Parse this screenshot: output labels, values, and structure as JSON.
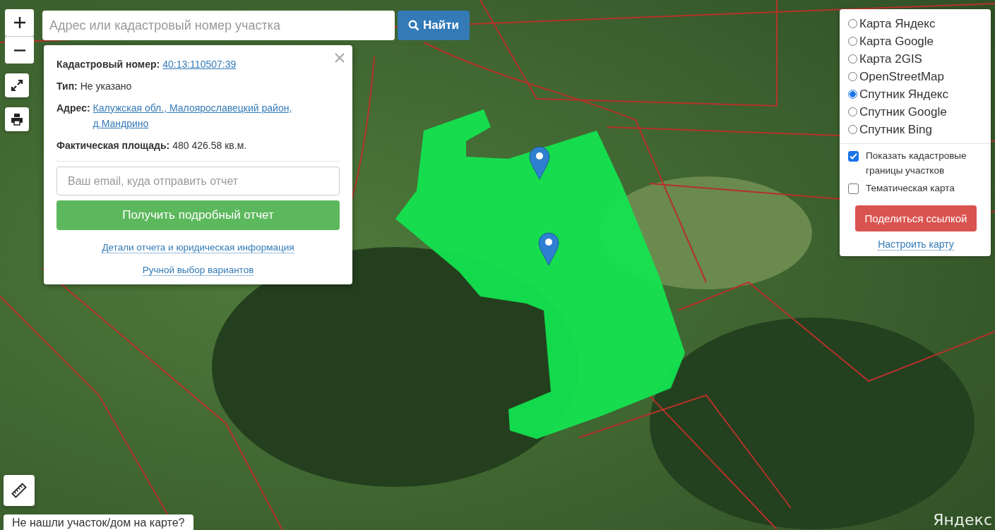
{
  "search": {
    "placeholder": "Адрес или кадастровый номер участка",
    "button": "Найти"
  },
  "info_popup": {
    "fields": [
      {
        "label": "Кадастровый номер:",
        "value": "40:13:110507:39",
        "kind": "link"
      },
      {
        "label": "Тип:",
        "value": "Не указано",
        "kind": "text"
      },
      {
        "label": "Адрес:",
        "value": "Калужская обл., Малоярославецкий район, д.Мандрино",
        "kind": "link"
      },
      {
        "label": "Фактическая площадь:",
        "value": "480 426.58 кв.м.",
        "kind": "text"
      }
    ],
    "email_placeholder": "Ваш email, куда отправить отчет",
    "report_button": "Получить подробный отчет",
    "links": [
      "Детали отчета и юридическая информация",
      "Ручной выбор вариантов"
    ]
  },
  "layers": {
    "options": [
      {
        "label": "Карта Яндекс",
        "selected": false
      },
      {
        "label": "Карта Google",
        "selected": false
      },
      {
        "label": "Карта 2GIS",
        "selected": false
      },
      {
        "label": "OpenStreetMap",
        "selected": false
      },
      {
        "label": "Спутник Яндекс",
        "selected": true
      },
      {
        "label": "Спутник Google",
        "selected": false
      },
      {
        "label": "Спутник Bing",
        "selected": false
      }
    ],
    "toggles": [
      {
        "label": "Показать кадастровые границы участков",
        "checked": true
      },
      {
        "label": "Тематическая карта",
        "checked": false
      }
    ],
    "share_button": "Поделиться ссылкой",
    "settings_link": "Настроить карту"
  },
  "bottom_notice": "Не нашли участок/дом на карте?",
  "map_attribution": "Яндекс"
}
